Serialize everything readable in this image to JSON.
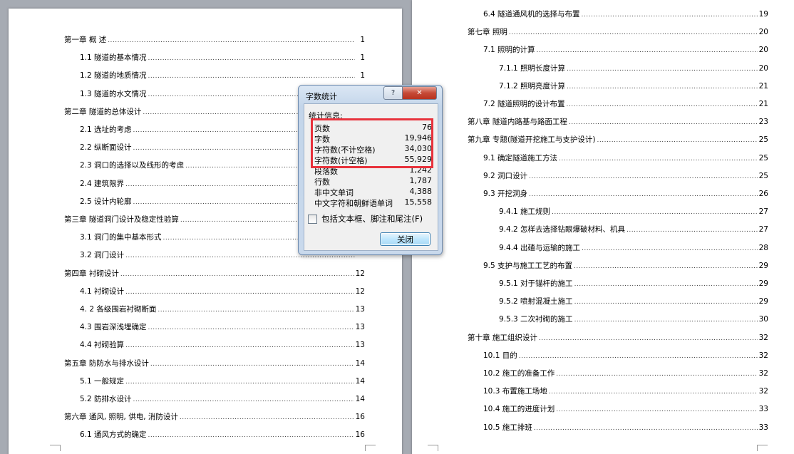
{
  "left_toc": [
    {
      "text": "第一章 概   述",
      "page": "1",
      "level": 0
    },
    {
      "text": "1.1 隧道的基本情况",
      "page": "1",
      "level": 1
    },
    {
      "text": "1.2 隧道的地质情况",
      "page": "1",
      "level": 1
    },
    {
      "text": "1.3 隧道的水文情况",
      "page": "",
      "level": 1
    },
    {
      "text": "第二章 隧道的总体设计",
      "page": "",
      "level": 0
    },
    {
      "text": "2.1 选址的考虑",
      "page": "",
      "level": 1
    },
    {
      "text": "2.2 纵断面设计",
      "page": "",
      "level": 1
    },
    {
      "text": "2.3 洞口的选择以及线形的考虑",
      "page": "",
      "level": 1
    },
    {
      "text": "2.4 建筑限界",
      "page": "",
      "level": 1
    },
    {
      "text": "2.5 设计内轮廓",
      "page": "",
      "level": 1
    },
    {
      "text": "第三章 隧道洞门设计及稳定性验算",
      "page": "",
      "level": 0
    },
    {
      "text": "3.1 洞门的集中基本形式",
      "page": "",
      "level": 1
    },
    {
      "text": "3.2 洞门设计",
      "page": "",
      "level": 1
    },
    {
      "text": "第四章 衬砌设计",
      "page": "12",
      "level": 0
    },
    {
      "text": "4.1 衬砌设计",
      "page": "12",
      "level": 1
    },
    {
      "text": "4. 2 各级围岩衬砌断面",
      "page": "13",
      "level": 1
    },
    {
      "text": "4.3 围岩深浅埋确定",
      "page": "13",
      "level": 1
    },
    {
      "text": "4.4 衬砌验算",
      "page": "13",
      "level": 1
    },
    {
      "text": "第五章 防防水与排水设计",
      "page": "14",
      "level": 0
    },
    {
      "text": "5.1 一般规定",
      "page": "14",
      "level": 1
    },
    {
      "text": "5.2 防排水设计",
      "page": "14",
      "level": 1
    },
    {
      "text": "第六章 通风, 照明, 供电, 消防设计",
      "page": "16",
      "level": 0
    },
    {
      "text": "6.1 通风方式的确定",
      "page": "16",
      "level": 1
    }
  ],
  "right_toc": [
    {
      "text": "6.4 隧道通风机的选择与布置",
      "page": "19",
      "level": 1
    },
    {
      "text": "第七章    照明",
      "page": "20",
      "level": 0
    },
    {
      "text": "7.1 照明的计算",
      "page": "20",
      "level": 1
    },
    {
      "text": "7.1.1 照明长度计算",
      "page": "20",
      "level": 2
    },
    {
      "text": "7.1.2 照明亮度计算",
      "page": "21",
      "level": 2
    },
    {
      "text": "7.2 隧道照明的设计布置",
      "page": "21",
      "level": 1
    },
    {
      "text": "第八章 隧道内路基与路面工程",
      "page": "23",
      "level": 0
    },
    {
      "text": "第九章 专题(隧道开挖施工与支护设计)",
      "page": "25",
      "level": 0
    },
    {
      "text": "9.1 确定隧道施工方法",
      "page": "25",
      "level": 1
    },
    {
      "text": "9.2 洞口设计",
      "page": "25",
      "level": 1
    },
    {
      "text": "9.3 开挖洞身",
      "page": "26",
      "level": 1
    },
    {
      "text": "9.4.1 施工规则",
      "page": "27",
      "level": 2
    },
    {
      "text": "9.4.2 怎样去选择钻眼爆破材料、机具",
      "page": "27",
      "level": 2
    },
    {
      "text": "9.4.4 出碴与运输的施工",
      "page": "28",
      "level": 2
    },
    {
      "text": "9.5 支护与施工工艺的布置",
      "page": "29",
      "level": 1
    },
    {
      "text": "9.5.1 对于锚杆的施工",
      "page": "29",
      "level": 2
    },
    {
      "text": "9.5.2 喷射混凝土施工",
      "page": "29",
      "level": 2
    },
    {
      "text": "9.5.3 二次衬砌的施工",
      "page": "30",
      "level": 2
    },
    {
      "text": "第十章 施工组织设计",
      "page": "32",
      "level": 0
    },
    {
      "text": "10.1 目的",
      "page": "32",
      "level": 1
    },
    {
      "text": "10.2 施工的准备工作",
      "page": "32",
      "level": 1
    },
    {
      "text": "10.3 布置施工场地",
      "page": "32",
      "level": 1
    },
    {
      "text": "10.4 施工的进度计划",
      "page": "33",
      "level": 1
    },
    {
      "text": "10.5 施工排班",
      "page": "33",
      "level": 1
    }
  ],
  "dialog": {
    "title": "字数统计",
    "help_label": "?",
    "close_x_label": "✕",
    "stats_heading": "统计信息:",
    "stats": [
      {
        "label": "页数",
        "value": "76"
      },
      {
        "label": "字数",
        "value": "19,946"
      },
      {
        "label": "字符数(不计空格)",
        "value": "34,030"
      },
      {
        "label": "字符数(计空格)",
        "value": "55,929"
      },
      {
        "label": "段落数",
        "value": "1,242"
      },
      {
        "label": "行数",
        "value": "1,787"
      },
      {
        "label": "非中文单词",
        "value": "4,388"
      },
      {
        "label": "中文字符和朝鲜语单词",
        "value": "15,558"
      }
    ],
    "checkbox_label": "包括文本框、脚注和尾注(F)",
    "close_button_label": "关闭"
  }
}
